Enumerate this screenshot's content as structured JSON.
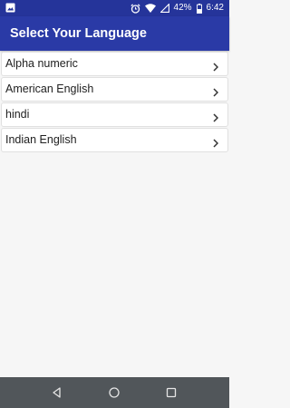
{
  "status_bar": {
    "battery_percent": "42%",
    "time": "6:42",
    "icons": [
      "image-notification-icon",
      "alarm-icon",
      "wifi-icon",
      "signal-icon",
      "battery-icon"
    ]
  },
  "app_bar": {
    "title": "Select Your Language",
    "color": "#2a3aa6"
  },
  "languages": [
    {
      "label": "Alpha numeric",
      "icon": "chevron-right-icon"
    },
    {
      "label": "American English",
      "icon": "chevron-right-icon"
    },
    {
      "label": "hindi",
      "icon": "chevron-right-icon"
    },
    {
      "label": "Indian English",
      "icon": "chevron-right-icon"
    }
  ],
  "nav_bar": {
    "icons": [
      "back-icon",
      "home-icon",
      "recents-icon"
    ],
    "color": "#51565a"
  }
}
